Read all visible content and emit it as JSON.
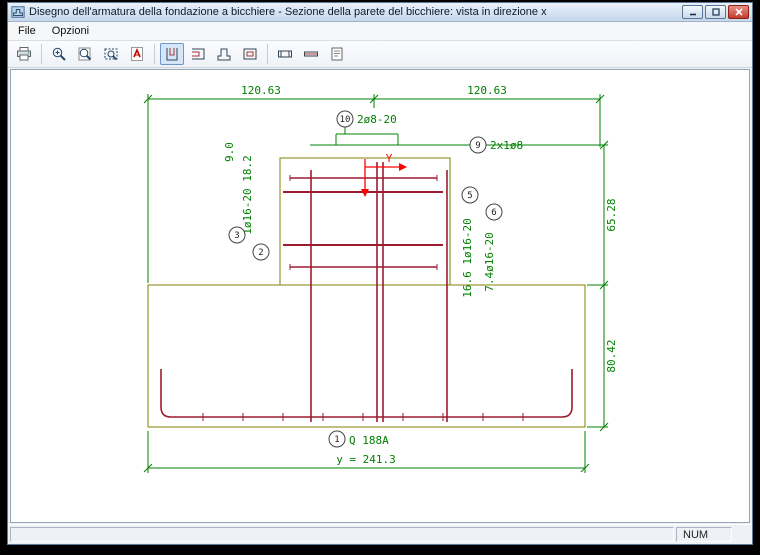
{
  "window": {
    "title": "Disegno dell'armatura della fondazione a bicchiere - Sezione della parete del bicchiere: vista in direzione x"
  },
  "menubar": {
    "items": [
      {
        "label": "File"
      },
      {
        "label": "Opzioni"
      }
    ]
  },
  "toolbar": {
    "icons": [
      "printer-icon",
      "zoom-in-icon",
      "zoom-page-icon",
      "zoom-window-icon",
      "pdf-export-icon",
      "section-wall-x-icon",
      "section-wall-y-icon",
      "section-plinth-x-icon",
      "section-plinth-y-icon",
      "beam-top-view-icon",
      "beam-side-view-icon",
      "print-preview-icon"
    ]
  },
  "statusbar": {
    "num_label": "NUM"
  },
  "drawing": {
    "dimensions": {
      "top_left": "120.63",
      "top_right": "120.63",
      "right_upper": "65.28",
      "right_lower": "80.42",
      "bottom_total": "y = 241.3",
      "left_top_offset": "9.0"
    },
    "rebar_labels": {
      "pos10": {
        "num": "10",
        "text": "2ø8-20"
      },
      "pos9": {
        "num": "9",
        "text": "2x1ø8"
      },
      "pos5": {
        "num": "5",
        "text": "16.6 1ø16-20"
      },
      "pos6": {
        "num": "6",
        "text": "7.4ø16-20"
      },
      "pos3": {
        "num": "3",
        "text": "1ø16-20 18.2"
      },
      "pos2": {
        "num": "2"
      },
      "pos1": {
        "num": "1",
        "text": "Q 188A"
      }
    },
    "axis": {
      "horizontal": "Y"
    }
  }
}
